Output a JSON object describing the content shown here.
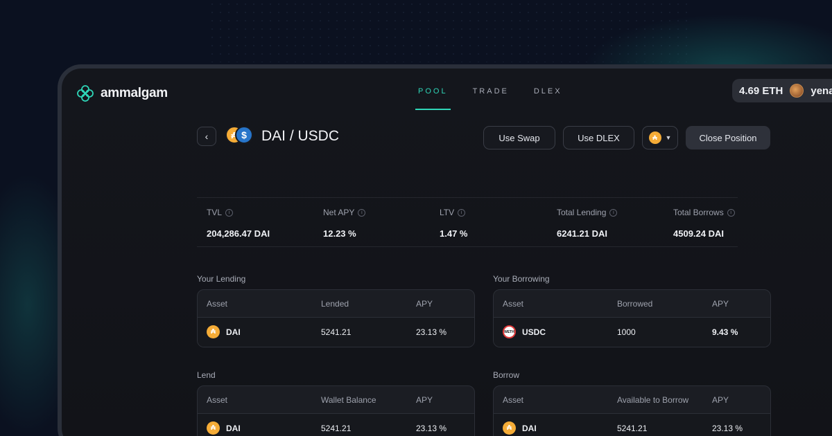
{
  "brand": {
    "name": "ammalgam"
  },
  "nav": {
    "items": [
      "POOL",
      "TRADE",
      "DLEX"
    ],
    "active": "POOL"
  },
  "wallet": {
    "balance": "4.69 ETH",
    "user": "yena"
  },
  "pair": {
    "title": "DAI / USDC"
  },
  "actions": {
    "swap": "Use Swap",
    "dlex": "Use DLEX",
    "close": "Close Position"
  },
  "stats": [
    {
      "label": "TVL",
      "value": "204,286.47 DAI"
    },
    {
      "label": "Net APY",
      "value": "12.23 %"
    },
    {
      "label": "LTV",
      "value": "1.47 %"
    },
    {
      "label": "Total Lending",
      "value": "6241.21 DAI"
    },
    {
      "label": "Total Borrows",
      "value": "4509.24 DAI"
    }
  ],
  "your_lending": {
    "title": "Your Lending",
    "headers": [
      "Asset",
      "Lended",
      "APY"
    ],
    "rows": [
      {
        "asset": "DAI",
        "amount": "5241.21",
        "apy": "23.13 %"
      }
    ]
  },
  "your_borrowing": {
    "title": "Your Borrowing",
    "headers": [
      "Asset",
      "Borrowed",
      "APY"
    ],
    "rows": [
      {
        "asset": "USDC",
        "amount": "1000",
        "apy": "9.43 %"
      }
    ]
  },
  "lend": {
    "title": "Lend",
    "headers": [
      "Asset",
      "Wallet Balance",
      "APY"
    ],
    "rows": [
      {
        "asset": "DAI",
        "amount": "5241.21",
        "apy": "23.13 %"
      }
    ]
  },
  "borrow": {
    "title": "Borrow",
    "headers": [
      "Asset",
      "Available to Borrow",
      "APY"
    ],
    "rows": [
      {
        "asset": "DAI",
        "amount": "5241.21",
        "apy": "23.13 %"
      }
    ]
  },
  "colors": {
    "accent": "#2fd6b8",
    "dai": "#f5ac37",
    "usdc": "#2775ca"
  }
}
